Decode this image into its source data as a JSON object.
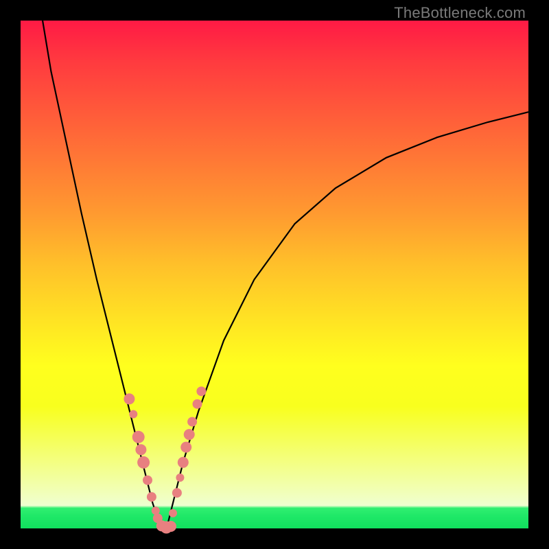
{
  "watermark": "TheBottleneck.com",
  "chart_data": {
    "type": "line",
    "title": "",
    "xlabel": "",
    "ylabel": "",
    "xlim": [
      0,
      1
    ],
    "ylim": [
      0,
      1
    ],
    "series": [
      {
        "name": "curve",
        "x": [
          0.04,
          0.06,
          0.09,
          0.12,
          0.15,
          0.18,
          0.2,
          0.22,
          0.235,
          0.25,
          0.26,
          0.27,
          0.28,
          0.285,
          0.29,
          0.3,
          0.32,
          0.35,
          0.4,
          0.46,
          0.54,
          0.62,
          0.72,
          0.82,
          0.92,
          1.0
        ],
        "y": [
          1.02,
          0.9,
          0.76,
          0.62,
          0.49,
          0.37,
          0.29,
          0.21,
          0.15,
          0.09,
          0.05,
          0.02,
          0.0,
          0.0,
          0.01,
          0.05,
          0.13,
          0.23,
          0.37,
          0.49,
          0.6,
          0.67,
          0.73,
          0.77,
          0.8,
          0.82
        ]
      }
    ],
    "markers": [
      {
        "x": 0.214,
        "y": 0.255,
        "r": 8
      },
      {
        "x": 0.222,
        "y": 0.225,
        "r": 6
      },
      {
        "x": 0.232,
        "y": 0.18,
        "r": 9
      },
      {
        "x": 0.237,
        "y": 0.155,
        "r": 8
      },
      {
        "x": 0.242,
        "y": 0.13,
        "r": 9
      },
      {
        "x": 0.25,
        "y": 0.095,
        "r": 7
      },
      {
        "x": 0.258,
        "y": 0.062,
        "r": 7
      },
      {
        "x": 0.266,
        "y": 0.035,
        "r": 6
      },
      {
        "x": 0.27,
        "y": 0.02,
        "r": 7
      },
      {
        "x": 0.278,
        "y": 0.005,
        "r": 8
      },
      {
        "x": 0.287,
        "y": 0.002,
        "r": 9
      },
      {
        "x": 0.296,
        "y": 0.004,
        "r": 8
      },
      {
        "x": 0.3,
        "y": 0.03,
        "r": 6
      },
      {
        "x": 0.308,
        "y": 0.07,
        "r": 7
      },
      {
        "x": 0.314,
        "y": 0.1,
        "r": 6
      },
      {
        "x": 0.32,
        "y": 0.13,
        "r": 8
      },
      {
        "x": 0.326,
        "y": 0.16,
        "r": 8
      },
      {
        "x": 0.332,
        "y": 0.185,
        "r": 8
      },
      {
        "x": 0.338,
        "y": 0.21,
        "r": 7
      },
      {
        "x": 0.348,
        "y": 0.245,
        "r": 7
      },
      {
        "x": 0.356,
        "y": 0.27,
        "r": 7
      }
    ],
    "gradient_stops": [
      {
        "pos": 0.0,
        "color": "#ff1a45"
      },
      {
        "pos": 0.68,
        "color": "#ffff1e"
      },
      {
        "pos": 0.96,
        "color": "#30ef70"
      },
      {
        "pos": 1.0,
        "color": "#10e15e"
      }
    ]
  }
}
